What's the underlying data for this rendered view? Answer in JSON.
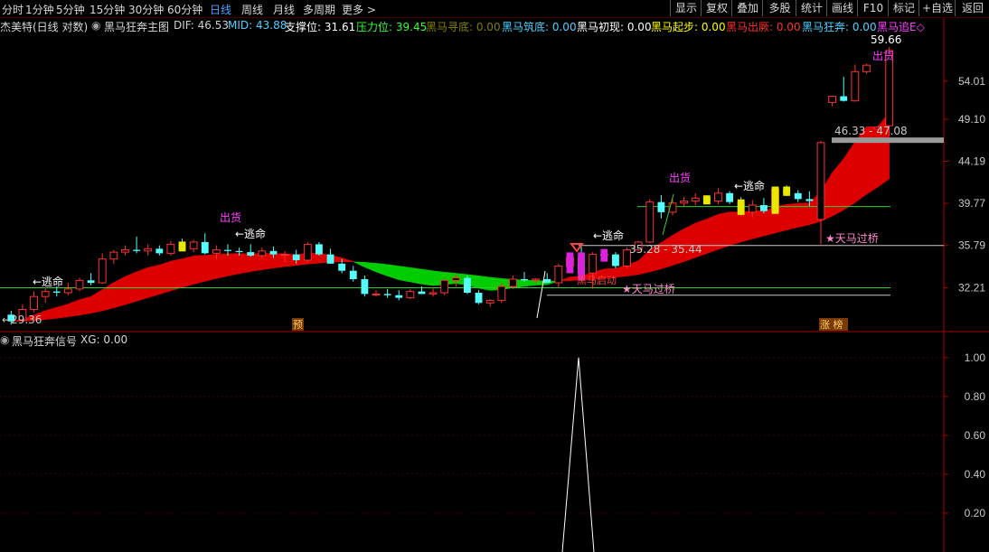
{
  "toolbar": {
    "tabs": [
      "分时",
      "1分钟",
      "5分钟",
      "15分钟",
      "30分钟",
      "60分钟",
      "日线",
      "周线",
      "月线",
      "多周期",
      "更多 >"
    ],
    "active_tab": "日线",
    "buttons": [
      "显示",
      "复权",
      "叠加",
      "多股",
      "统计",
      "画线",
      "F10",
      "标记",
      "+自选",
      "返回"
    ]
  },
  "main_info": {
    "title": "杰美特(日线 对数)",
    "indicator": "黑马狂奔主图",
    "items": [
      {
        "label": "DIF: 46.53",
        "color": "#d0d0d0"
      },
      {
        "label": "MID: 43.88",
        "color": "#4fd0ff"
      },
      {
        "label": "支撑位: 31.61",
        "color": "#ffffff"
      },
      {
        "label": "压力位: 39.45",
        "color": "#33ff33"
      },
      {
        "label": "黑马寻底: 0.00",
        "color": "#808000"
      },
      {
        "label": "黑马筑底: 0.00",
        "color": "#4fd0ff"
      },
      {
        "label": "黑马初现: 0.00",
        "color": "#ffffff"
      },
      {
        "label": "黑马起步: 0.00",
        "color": "#ffff00"
      },
      {
        "label": "黑马出厥: 0.00",
        "color": "#ff3030"
      },
      {
        "label": "黑马狂奔: 0.00",
        "color": "#4fd0ff"
      },
      {
        "label": "黑马追E◇",
        "color": "#ff40ff"
      }
    ]
  },
  "sub_info": {
    "indicator": "黑马狂奔信号",
    "value": "XG: 0.00"
  },
  "price_axis": [
    "54.01",
    "49.10",
    "44.19",
    "39.77",
    "35.79",
    "32.21"
  ],
  "sub_axis": [
    "1.00",
    "0.80",
    "0.60",
    "0.40",
    "0.20"
  ],
  "annotations": {
    "low_label": "←29.36",
    "high_label": "59.66",
    "range_label": "46.33 - 47.08",
    "mid_range_label": "35.28 - 35.44",
    "escape_labels": [
      "←逃命",
      "←逃命",
      "←逃命",
      "←逃命"
    ],
    "ship_labels": [
      "出货",
      "出货",
      "出货"
    ],
    "bridge_labels": [
      "天马过桥",
      "天马过桥"
    ],
    "kill_label": "黑马启动",
    "pre_badge": "预",
    "limit_badge": "涨 榜"
  },
  "colors": {
    "up": "#ff3232",
    "down": "#54ffff",
    "band_red": "#dd0000",
    "band_green": "#00cc00",
    "axis_border": "#b00000",
    "signal": "#ffffff"
  },
  "chart_data": {
    "type": "candlestick",
    "scale": "log",
    "price_ylim": [
      29.36,
      59.66
    ],
    "candles": [
      {
        "o": 30.1,
        "h": 30.4,
        "l": 29.36,
        "c": 29.6
      },
      {
        "o": 29.7,
        "h": 30.9,
        "l": 29.5,
        "c": 30.5
      },
      {
        "o": 30.5,
        "h": 31.9,
        "l": 30.3,
        "c": 31.5
      },
      {
        "o": 31.5,
        "h": 32.2,
        "l": 31.0,
        "c": 31.9
      },
      {
        "o": 31.9,
        "h": 32.3,
        "l": 31.5,
        "c": 31.8
      },
      {
        "o": 31.8,
        "h": 32.6,
        "l": 31.6,
        "c": 32.1
      },
      {
        "o": 32.1,
        "h": 33.0,
        "l": 31.9,
        "c": 32.8
      },
      {
        "o": 32.8,
        "h": 33.4,
        "l": 32.4,
        "c": 32.6
      },
      {
        "o": 32.6,
        "h": 35.1,
        "l": 32.5,
        "c": 34.6
      },
      {
        "o": 34.6,
        "h": 35.4,
        "l": 34.2,
        "c": 35.2
      },
      {
        "o": 35.2,
        "h": 35.8,
        "l": 34.9,
        "c": 35.4
      },
      {
        "o": 35.4,
        "h": 36.6,
        "l": 35.1,
        "c": 35.3
      },
      {
        "o": 35.3,
        "h": 35.9,
        "l": 34.9,
        "c": 35.5
      },
      {
        "o": 35.5,
        "h": 35.8,
        "l": 34.9,
        "c": 35.1
      },
      {
        "o": 35.1,
        "h": 36.2,
        "l": 34.9,
        "c": 35.9
      },
      {
        "o": 35.9,
        "h": 36.4,
        "l": 35.4,
        "c": 35.5
      },
      {
        "o": 35.5,
        "h": 36.3,
        "l": 35.2,
        "c": 36.1
      },
      {
        "o": 36.1,
        "h": 36.9,
        "l": 35.0,
        "c": 35.1
      },
      {
        "o": 35.1,
        "h": 35.8,
        "l": 34.6,
        "c": 35.4
      },
      {
        "o": 35.4,
        "h": 35.9,
        "l": 34.9,
        "c": 35.3
      },
      {
        "o": 35.3,
        "h": 35.6,
        "l": 34.9,
        "c": 35.2
      },
      {
        "o": 35.2,
        "h": 35.9,
        "l": 34.8,
        "c": 34.9
      },
      {
        "o": 34.9,
        "h": 35.6,
        "l": 34.6,
        "c": 35.3
      },
      {
        "o": 35.3,
        "h": 35.7,
        "l": 34.7,
        "c": 35.0
      },
      {
        "o": 35.0,
        "h": 35.3,
        "l": 34.3,
        "c": 35.0
      },
      {
        "o": 35.0,
        "h": 35.4,
        "l": 34.2,
        "c": 34.5
      },
      {
        "o": 34.5,
        "h": 36.1,
        "l": 34.3,
        "c": 35.9
      },
      {
        "o": 35.9,
        "h": 36.1,
        "l": 34.9,
        "c": 35.0
      },
      {
        "o": 35.0,
        "h": 35.5,
        "l": 34.2,
        "c": 34.2
      },
      {
        "o": 34.2,
        "h": 34.6,
        "l": 33.4,
        "c": 33.6
      },
      {
        "o": 33.6,
        "h": 34.0,
        "l": 32.7,
        "c": 32.9
      },
      {
        "o": 32.9,
        "h": 33.2,
        "l": 31.5,
        "c": 31.7
      },
      {
        "o": 31.7,
        "h": 32.0,
        "l": 31.5,
        "c": 31.7
      },
      {
        "o": 31.7,
        "h": 32.1,
        "l": 31.4,
        "c": 31.6
      },
      {
        "o": 31.6,
        "h": 32.0,
        "l": 31.2,
        "c": 31.4
      },
      {
        "o": 31.4,
        "h": 32.1,
        "l": 31.3,
        "c": 31.9
      },
      {
        "o": 31.9,
        "h": 32.3,
        "l": 31.7,
        "c": 31.7
      },
      {
        "o": 31.7,
        "h": 32.2,
        "l": 31.5,
        "c": 31.8
      },
      {
        "o": 31.8,
        "h": 32.9,
        "l": 31.6,
        "c": 32.8
      },
      {
        "o": 32.8,
        "h": 33.3,
        "l": 32.3,
        "c": 33.0
      },
      {
        "o": 33.0,
        "h": 33.2,
        "l": 31.7,
        "c": 31.8
      },
      {
        "o": 31.8,
        "h": 32.0,
        "l": 30.9,
        "c": 31.0
      },
      {
        "o": 31.0,
        "h": 31.3,
        "l": 30.7,
        "c": 31.2
      },
      {
        "o": 31.2,
        "h": 32.6,
        "l": 31.0,
        "c": 32.3
      },
      {
        "o": 32.3,
        "h": 33.2,
        "l": 32.1,
        "c": 32.9
      },
      {
        "o": 32.9,
        "h": 33.5,
        "l": 32.7,
        "c": 32.8
      },
      {
        "o": 32.8,
        "h": 33.0,
        "l": 32.6,
        "c": 32.9
      },
      {
        "o": 32.9,
        "h": 33.4,
        "l": 32.6,
        "c": 32.6
      },
      {
        "o": 32.6,
        "h": 34.2,
        "l": 32.2,
        "c": 34.0
      },
      {
        "o": 34.0,
        "h": 34.9,
        "l": 33.8,
        "c": 34.7
      },
      {
        "o": 34.7,
        "h": 35.7,
        "l": 33.2,
        "c": 33.4
      },
      {
        "o": 33.4,
        "h": 35.2,
        "l": 32.1,
        "c": 35.0
      },
      {
        "o": 35.0,
        "h": 35.5,
        "l": 34.8,
        "c": 35.0
      },
      {
        "o": 35.0,
        "h": 35.2,
        "l": 33.8,
        "c": 34.0
      },
      {
        "o": 34.0,
        "h": 35.6,
        "l": 33.8,
        "c": 35.4
      },
      {
        "o": 35.4,
        "h": 36.2,
        "l": 35.3,
        "c": 36.1
      },
      {
        "o": 36.1,
        "h": 40.2,
        "l": 36.0,
        "c": 39.9
      },
      {
        "o": 39.9,
        "h": 40.6,
        "l": 38.3,
        "c": 38.9
      },
      {
        "o": 38.9,
        "h": 40.2,
        "l": 38.6,
        "c": 39.8
      },
      {
        "o": 39.8,
        "h": 40.4,
        "l": 39.5,
        "c": 40.0
      },
      {
        "o": 40.0,
        "h": 40.8,
        "l": 39.6,
        "c": 40.3
      },
      {
        "o": 40.3,
        "h": 40.6,
        "l": 39.8,
        "c": 40.0
      },
      {
        "o": 40.0,
        "h": 41.3,
        "l": 39.7,
        "c": 40.8
      },
      {
        "o": 40.8,
        "h": 41.0,
        "l": 39.7,
        "c": 39.9
      },
      {
        "o": 39.9,
        "h": 40.4,
        "l": 38.6,
        "c": 38.9
      },
      {
        "o": 38.9,
        "h": 40.1,
        "l": 38.4,
        "c": 39.6
      },
      {
        "o": 39.6,
        "h": 40.3,
        "l": 38.8,
        "c": 39.0
      },
      {
        "o": 39.0,
        "h": 41.4,
        "l": 38.9,
        "c": 41.2
      },
      {
        "o": 41.2,
        "h": 41.6,
        "l": 40.5,
        "c": 40.8
      },
      {
        "o": 40.8,
        "h": 41.1,
        "l": 39.9,
        "c": 40.2
      },
      {
        "o": 40.2,
        "h": 41.0,
        "l": 39.5,
        "c": 40.0
      },
      {
        "o": 38.2,
        "h": 46.5,
        "l": 35.9,
        "c": 46.3
      },
      {
        "o": 51.2,
        "h": 52.1,
        "l": 50.7,
        "c": 52.0
      },
      {
        "o": 52.0,
        "h": 54.6,
        "l": 51.3,
        "c": 51.4
      },
      {
        "o": 51.4,
        "h": 56.3,
        "l": 51.3,
        "c": 55.3
      },
      {
        "o": 55.3,
        "h": 56.4,
        "l": 55.0,
        "c": 56.2
      },
      {
        "o": 47.9,
        "h": 48.3,
        "l": 47.8,
        "c": 48.1
      },
      {
        "o": 48.3,
        "h": 58.8,
        "l": 47.1,
        "c": 58.3
      }
    ],
    "signal_xg": {
      "values": [
        0,
        0,
        0,
        0,
        0,
        0,
        0,
        1,
        0,
        0,
        0,
        0,
        0,
        0
      ],
      "peak_value": 1.0
    },
    "sub_ylim": [
      0,
      1.05
    ]
  }
}
